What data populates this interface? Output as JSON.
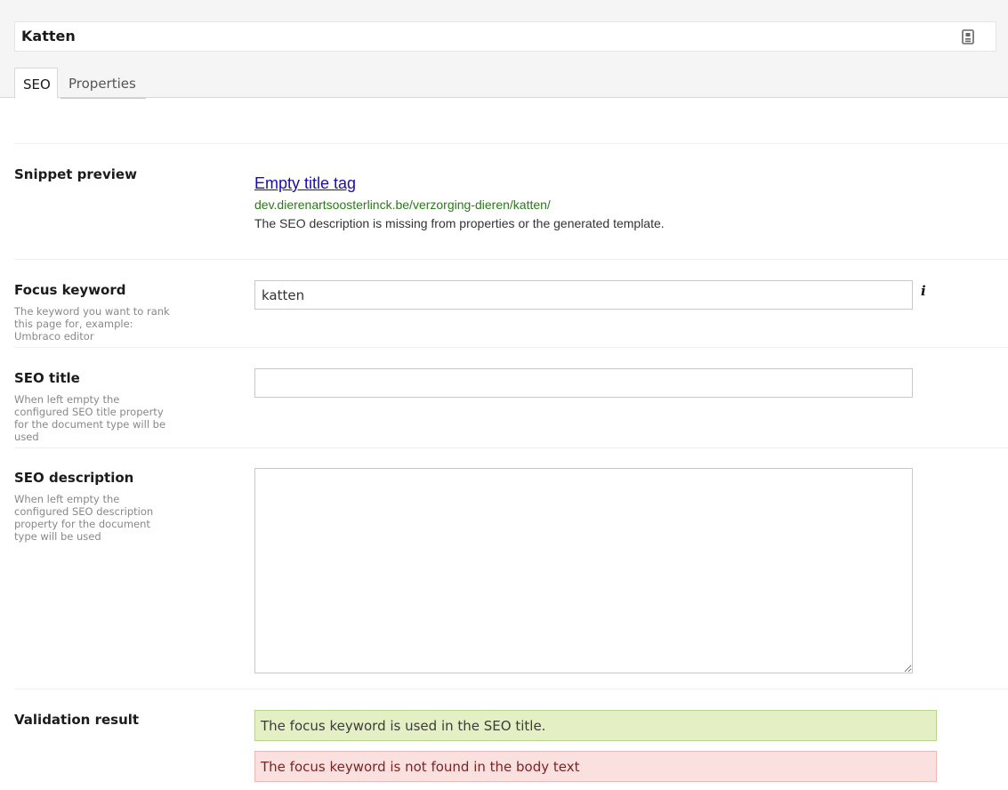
{
  "header": {
    "name_value": "Katten",
    "tabs": [
      {
        "label": "SEO"
      },
      {
        "label": "Properties"
      }
    ]
  },
  "snippet": {
    "label": "Snippet preview",
    "title": "Empty title tag",
    "url": "dev.dierenartsoosterlinck.be/verzorging-dieren/katten/",
    "description": "The SEO description is missing from properties or the generated template."
  },
  "focus_keyword": {
    "label": "Focus keyword",
    "description": "The keyword you want to rank this page for, example: Umbraco editor",
    "value": "katten",
    "info_icon": "i"
  },
  "seo_title": {
    "label": "SEO title",
    "description": "When left empty the configured SEO title property for the document type will be used",
    "value": ""
  },
  "seo_description": {
    "label": "SEO description",
    "description": "When left empty the configured SEO description property for the document type will be used",
    "value": ""
  },
  "validation": {
    "label": "Validation result",
    "results": [
      {
        "text": "The focus keyword is used in the SEO title.",
        "status": "success",
        "color": "#e4efc4"
      },
      {
        "text": "The focus keyword is not found in the body text",
        "status": "error",
        "color": "#fbe0e0"
      }
    ]
  }
}
